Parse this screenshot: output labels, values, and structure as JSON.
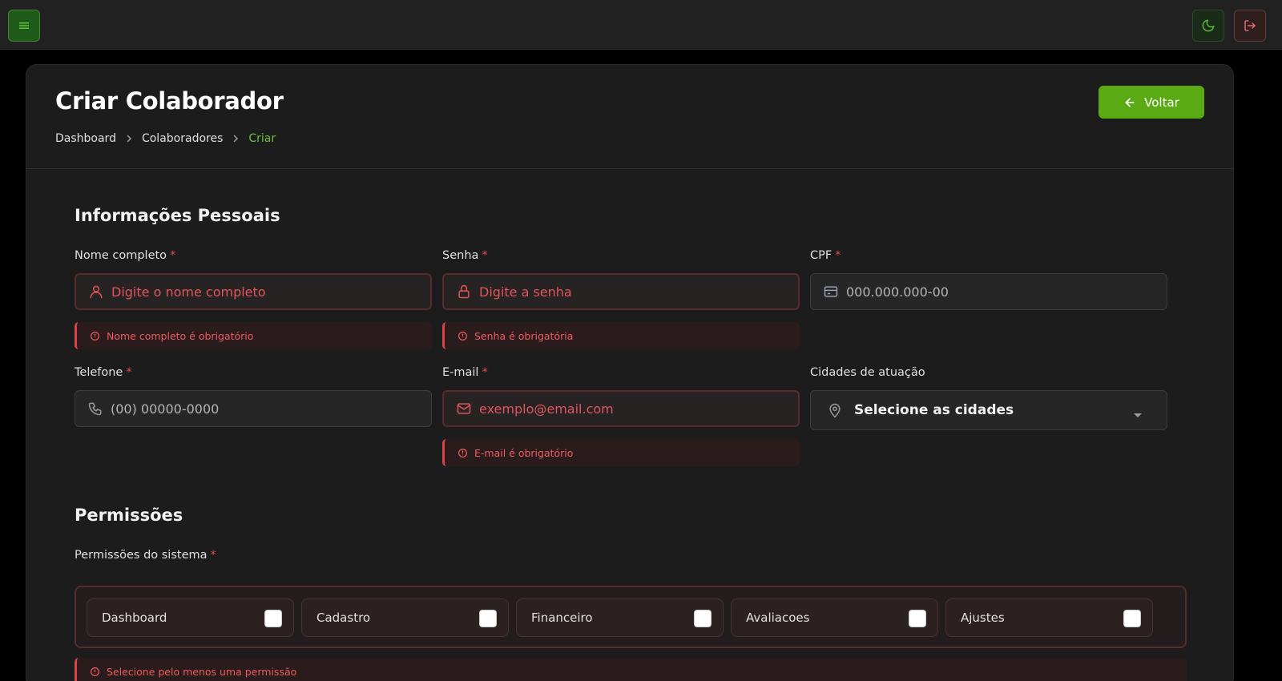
{
  "topbar": {
    "menu_icon": "hamburger-icon",
    "theme_icon": "moon-icon",
    "logout_icon": "logout-icon"
  },
  "header": {
    "title": "Criar Colaborador",
    "breadcrumb": [
      "Dashboard",
      "Colaboradores",
      "Criar"
    ],
    "back_label": "Voltar"
  },
  "personal": {
    "section_title": "Informações Pessoais",
    "required_mark": "*",
    "fields": {
      "name": {
        "label": "Nome completo",
        "placeholder": "Digite o nome completo",
        "error": "Nome completo é obrigatório"
      },
      "password": {
        "label": "Senha",
        "placeholder": "Digite a senha",
        "error": "Senha é obrigatória"
      },
      "cpf": {
        "label": "CPF",
        "placeholder": "000.000.000-00"
      },
      "phone": {
        "label": "Telefone",
        "placeholder": "(00) 00000-0000"
      },
      "email": {
        "label": "E-mail",
        "placeholder": "exemplo@email.com",
        "error": "E-mail é obrigatório"
      },
      "cities": {
        "label": "Cidades de atuação",
        "placeholder": "Selecione as cidades"
      }
    }
  },
  "permissions": {
    "section_title": "Permissões",
    "label": "Permissões do sistema",
    "options": [
      "Dashboard",
      "Cadastro",
      "Financeiro",
      "Avaliacoes",
      "Ajustes"
    ],
    "error": "Selecione pelo menos uma permissão"
  },
  "colors": {
    "accent": "#5aaa13",
    "error": "#e5484d",
    "background": "#1c1c1c"
  }
}
